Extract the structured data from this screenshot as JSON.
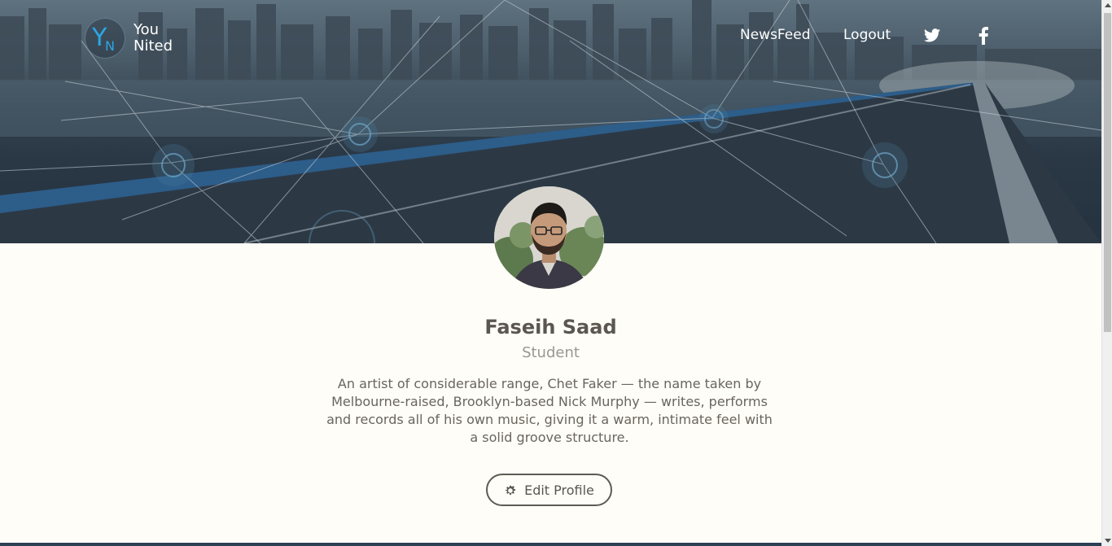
{
  "brand": {
    "line1": "You",
    "line2": "Nited",
    "mark_letter_1": "Y",
    "mark_letter_2": "N",
    "accent_color": "#2aa7e6"
  },
  "nav": {
    "newsfeed_label": "NewsFeed",
    "logout_label": "Logout",
    "twitter_icon": "twitter-icon",
    "facebook_icon": "facebook-icon"
  },
  "profile": {
    "name": "Faseih Saad",
    "role": "Student",
    "bio": "An artist of considerable range, Chet Faker — the name taken by Melbourne-raised, Brooklyn-based Nick Murphy — writes, performs and records all of his own music, giving it a warm, intimate feel with a solid groove structure.",
    "edit_button_label": "Edit Profile",
    "edit_button_icon": "gear-icon"
  },
  "colors": {
    "page_background": "#fffdf7",
    "name_text": "#5b5650",
    "role_text": "#9b9790",
    "bio_text": "#6a655e"
  }
}
